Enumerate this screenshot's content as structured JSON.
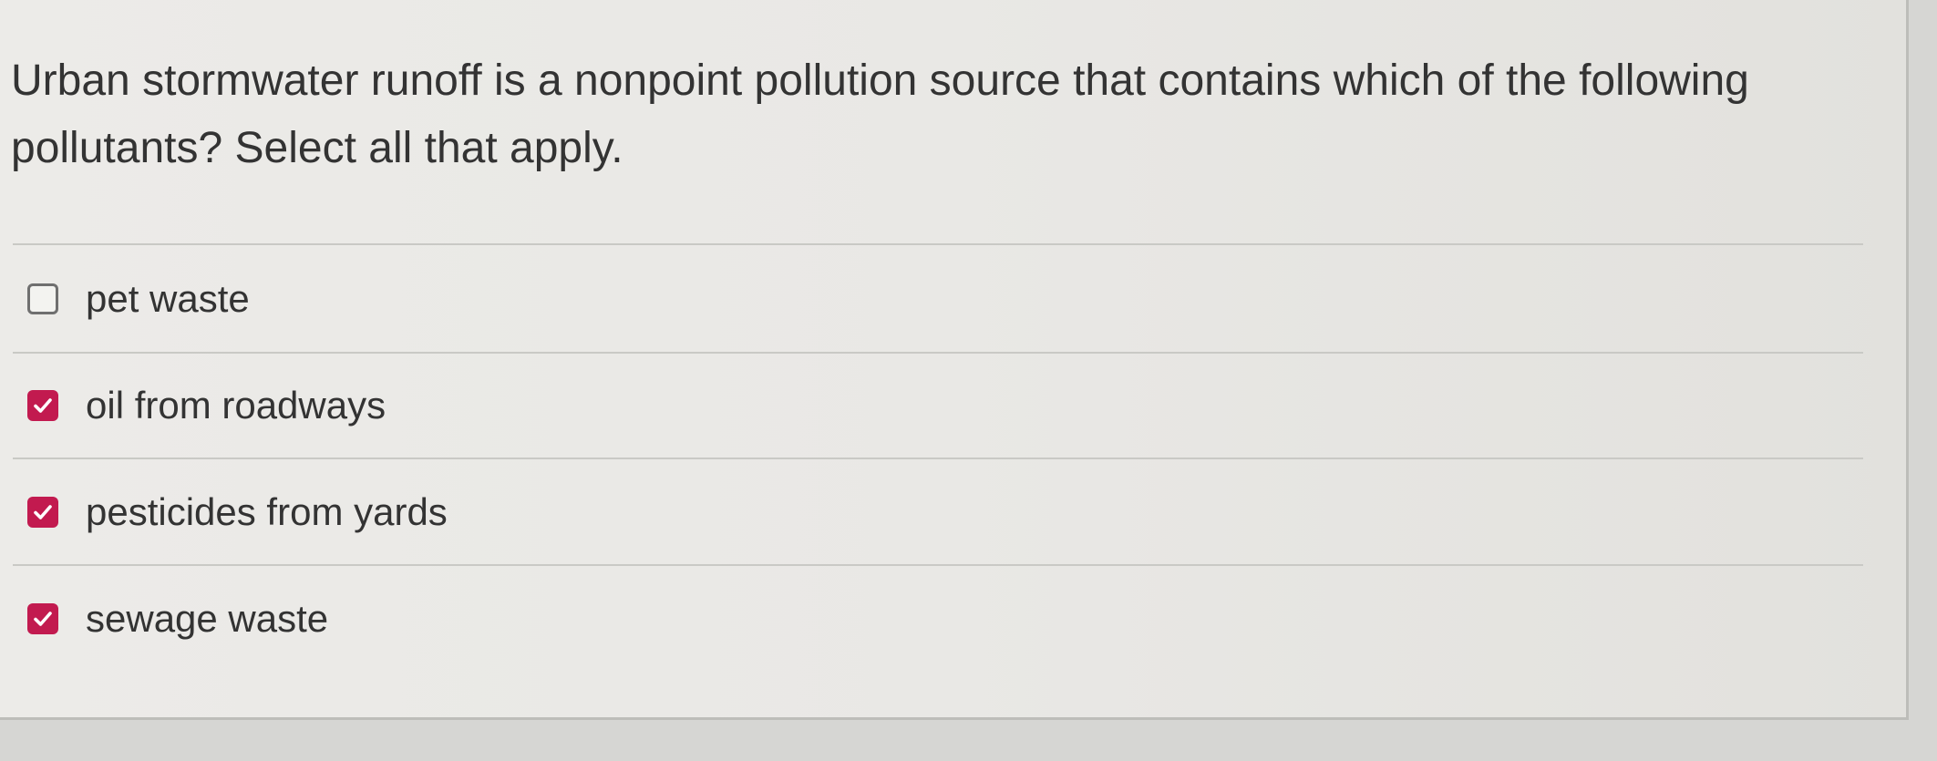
{
  "question": {
    "text": "Urban stormwater runoff is a nonpoint pollution source that contains which of the following pollutants? Select all that apply."
  },
  "options": [
    {
      "label": "pet waste",
      "checked": false
    },
    {
      "label": "oil from roadways",
      "checked": true
    },
    {
      "label": "pesticides from yards",
      "checked": true
    },
    {
      "label": "sewage waste",
      "checked": true
    }
  ],
  "colors": {
    "accent": "#c21a4f",
    "text": "#333333",
    "background": "#ebeae7"
  },
  "icons": {
    "checked": "checkmark-icon"
  }
}
